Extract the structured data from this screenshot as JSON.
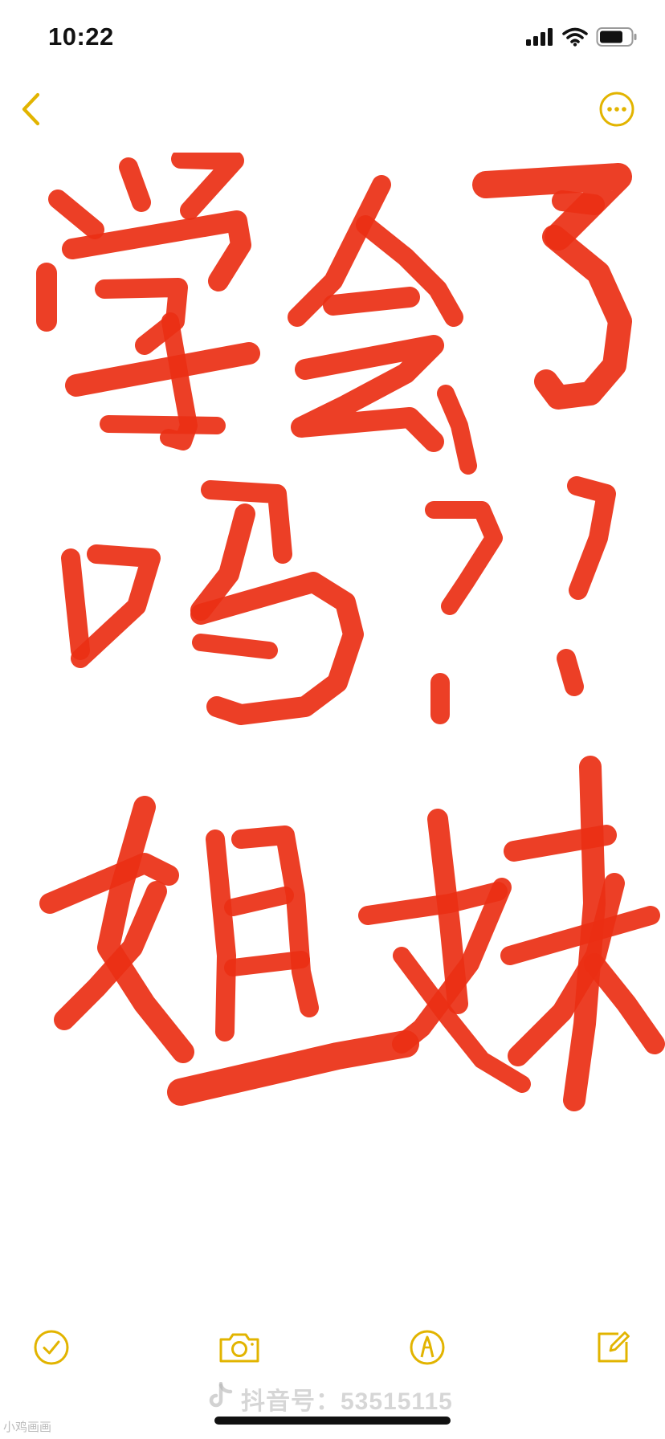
{
  "status_bar": {
    "time": "10:22",
    "icons": [
      "cellular-signal-icon",
      "wifi-icon",
      "battery-icon"
    ]
  },
  "nav": {
    "back_icon": "chevron-left-icon",
    "more_icon": "ellipsis-circle-icon"
  },
  "note": {
    "handwriting_lines": [
      "学会了",
      "吗？？",
      "姐妹"
    ],
    "ink_color": "#ea2f14"
  },
  "toolbar": {
    "items": [
      "checklist-icon",
      "camera-icon",
      "markup-pen-icon",
      "compose-icon"
    ]
  },
  "accent_color": "#e2b400",
  "watermark": {
    "text": "抖音号：53515115",
    "small_text": "小鸡画画"
  }
}
